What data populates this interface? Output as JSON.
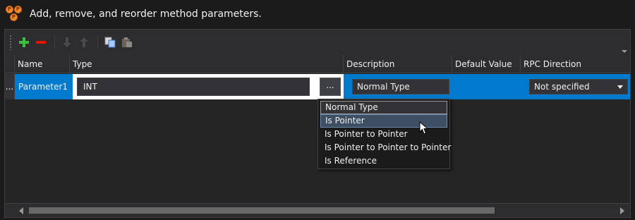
{
  "header": {
    "title": "Add, remove, and reorder method parameters.",
    "logo_letters": [
      "P",
      "P",
      "P"
    ]
  },
  "toolbar": {
    "buttons": [
      {
        "icon": "add-icon",
        "color": "#3fbf3f"
      },
      {
        "icon": "remove-icon",
        "color": "#e51400"
      },
      {
        "icon": "move-down-icon",
        "color": "#555555"
      },
      {
        "icon": "move-up-icon",
        "color": "#555555"
      },
      {
        "icon": "copy-icon",
        "color": "#a9c7ff"
      },
      {
        "icon": "paste-icon",
        "color": "#777777"
      }
    ]
  },
  "grid": {
    "columns": [
      "Name",
      "Type",
      "Description",
      "Default Value",
      "RPC Direction"
    ],
    "rows": [
      {
        "row_header": "...",
        "name": "Parameter1",
        "type": "INT",
        "type_browse": "...",
        "description": "Normal Type",
        "default_value": "",
        "rpc_direction": "Not specified"
      }
    ]
  },
  "description_dropdown": {
    "options": [
      "Normal Type",
      "Is Pointer",
      "Is Pointer to Pointer",
      "Is Pointer to Pointer to Pointer",
      "Is Reference"
    ],
    "current_index": 0,
    "hover_index": 1
  },
  "colors": {
    "selection": "#007acc",
    "background": "#252526",
    "logo": "#f28b2d"
  }
}
